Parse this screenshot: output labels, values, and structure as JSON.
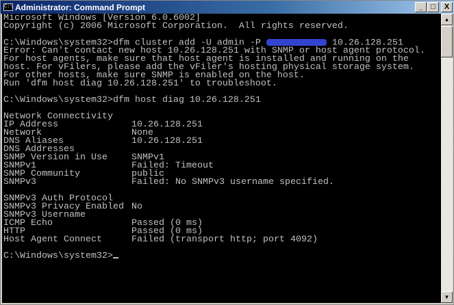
{
  "window": {
    "title": "Administrator: Command Prompt",
    "icon": "cmd-icon",
    "icon_text": "C:\\"
  },
  "controls": {
    "minimize": "_",
    "maximize": "□",
    "close": "X"
  },
  "console": {
    "header": [
      "Microsoft Windows [Version 6.0.6002]",
      "Copyright (c) 2006 Microsoft Corporation.  All rights reserved."
    ],
    "cmd1_prefix": "C:\\Windows\\system32>dfm cluster add -U admin -P ",
    "cmd1_suffix": "10.26.128.251",
    "error": [
      "Error: Can't contact new host 10.26.128.251 with SNMP or host agent protocol.",
      "For host agents, make sure that host agent is installed and running on the",
      "host. For vFilers, please add the vFiler's hosting physical storage system.",
      "For other hosts, make sure SNMP is enabled on the host.",
      "Run 'dfm host diag 10.26.128.251' to troubleshoot."
    ],
    "cmd2": "C:\\Windows\\system32>dfm host diag 10.26.128.251",
    "diag1": [
      {
        "label": "Network Connectivity",
        "value": ""
      },
      {
        "label": "IP Address",
        "value": "10.26.128.251"
      },
      {
        "label": "Network",
        "value": "None"
      },
      {
        "label": "DNS Aliases",
        "value": "10.26.128.251"
      },
      {
        "label": "DNS Addresses",
        "value": ""
      },
      {
        "label": "SNMP Version in Use",
        "value": "SNMPv1"
      },
      {
        "label": "SNMPv1",
        "value": "Failed: Timeout"
      },
      {
        "label": "SNMP Community",
        "value": "public"
      },
      {
        "label": "SNMPv3",
        "value": "Failed: No SNMPv3 username specified."
      }
    ],
    "diag2": [
      {
        "label": "SNMPv3 Auth Protocol",
        "value": ""
      },
      {
        "label": "SNMPv3 Privacy Enabled",
        "value": "No"
      },
      {
        "label": "SNMPv3 Username",
        "value": ""
      },
      {
        "label": "ICMP Echo",
        "value": "Passed (0 ms)"
      },
      {
        "label": "HTTP",
        "value": "Passed (0 ms)"
      },
      {
        "label": "Host Agent Connect",
        "value": "Failed (transport http; port 4092)"
      }
    ],
    "prompt": "C:\\Windows\\system32>"
  }
}
